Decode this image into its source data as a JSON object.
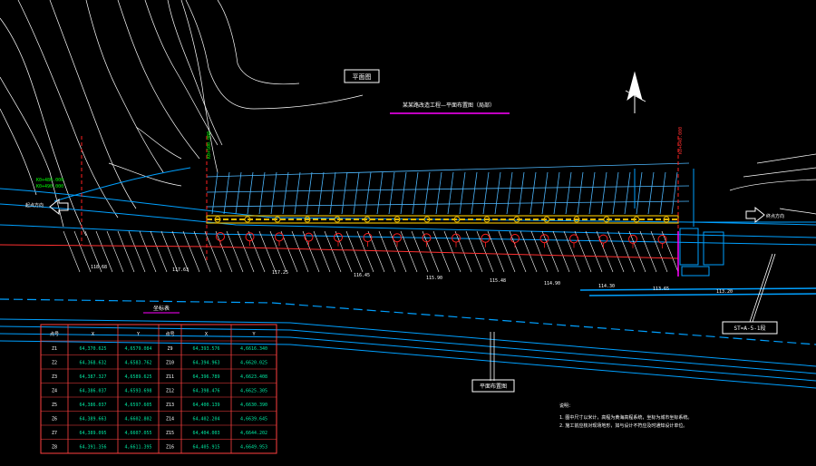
{
  "labels": {
    "box_top": "平面图",
    "project_title": "某某路改造工程—平面布置图（局部）",
    "box_right": "ST=A-5-1段",
    "box_mid": "平面布置图",
    "table_title": "坐标表",
    "notes_title": "说明：",
    "note_1": "1. 图中尺寸以米计，高程为黄海高程系统，坐标为城市坐标系统。",
    "note_2": "2. 施工前应核对现场地形，如与设计不符应及时通知设计单位。",
    "left_start": "起点方向",
    "right_end": "终点方向"
  },
  "dims": {
    "left_a": "K0+480.000",
    "left_b": "K0+490.000",
    "stake_left": "K0+500.000",
    "stake_right": "K0+640.000"
  },
  "elevations": [
    "118.68",
    "117.63",
    "117.25",
    "116.45",
    "115.90",
    "115.48",
    "114.90",
    "114.30",
    "113.65",
    "113.20"
  ],
  "coord_table": {
    "headers": [
      "点号",
      "X",
      "Y",
      "点号",
      "X",
      "Y"
    ],
    "rows": [
      [
        "Z1",
        "64,370.625",
        "4,6579.084",
        "Z9",
        "64,393.576",
        "4,6616.340"
      ],
      [
        "Z2",
        "64,368.632",
        "4,6583.762",
        "Z10",
        "64,394.963",
        "4,6620.025"
      ],
      [
        "Z3",
        "64,387.327",
        "4,6589.625",
        "Z11",
        "64,396.789",
        "4,6623.408"
      ],
      [
        "Z4",
        "64,386.037",
        "4,6593.698",
        "Z12",
        "64,398.476",
        "4,6625.305"
      ],
      [
        "Z5",
        "64,386.037",
        "4,6597.605",
        "Z13",
        "64,400.139",
        "4,6630.390"
      ],
      [
        "Z6",
        "64,389.663",
        "4,6602.802",
        "Z14",
        "64,402.204",
        "4,6639.645"
      ],
      [
        "Z7",
        "64,389.095",
        "4,6607.055",
        "Z15",
        "64,404.003",
        "4,6644.202"
      ],
      [
        "Z8",
        "64,391.356",
        "4,6611.395",
        "Z16",
        "64,405.915",
        "4,6649.953"
      ]
    ]
  },
  "colors": {
    "background": "#000000",
    "contour": "#ffffff",
    "road": "#00a0ff",
    "grid": "#4db8ff",
    "stake": "#ff2020",
    "pipe": "#e6b800",
    "label_green": "#00ff00",
    "magenta": "#ff00ff",
    "table_border": "#ff4040",
    "table_data": "#00e6a0"
  }
}
